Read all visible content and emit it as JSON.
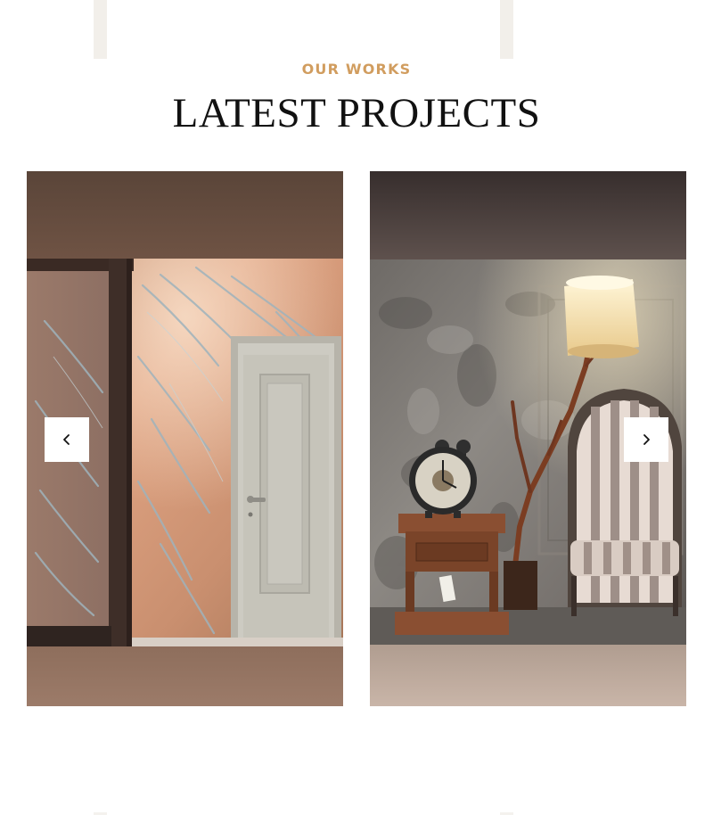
{
  "section": {
    "eyebrow": "OUR WORKS",
    "title": "LATEST PROJECTS"
  },
  "carousel": {
    "slides": [
      {
        "subject": "venetian plaster wall with door"
      },
      {
        "subject": "concrete wall with clock, lamp and armchair"
      }
    ],
    "prev_icon": "chevron-left-icon",
    "next_icon": "chevron-right-icon"
  },
  "colors": {
    "accent": "#d19d5f",
    "title": "#111111"
  }
}
